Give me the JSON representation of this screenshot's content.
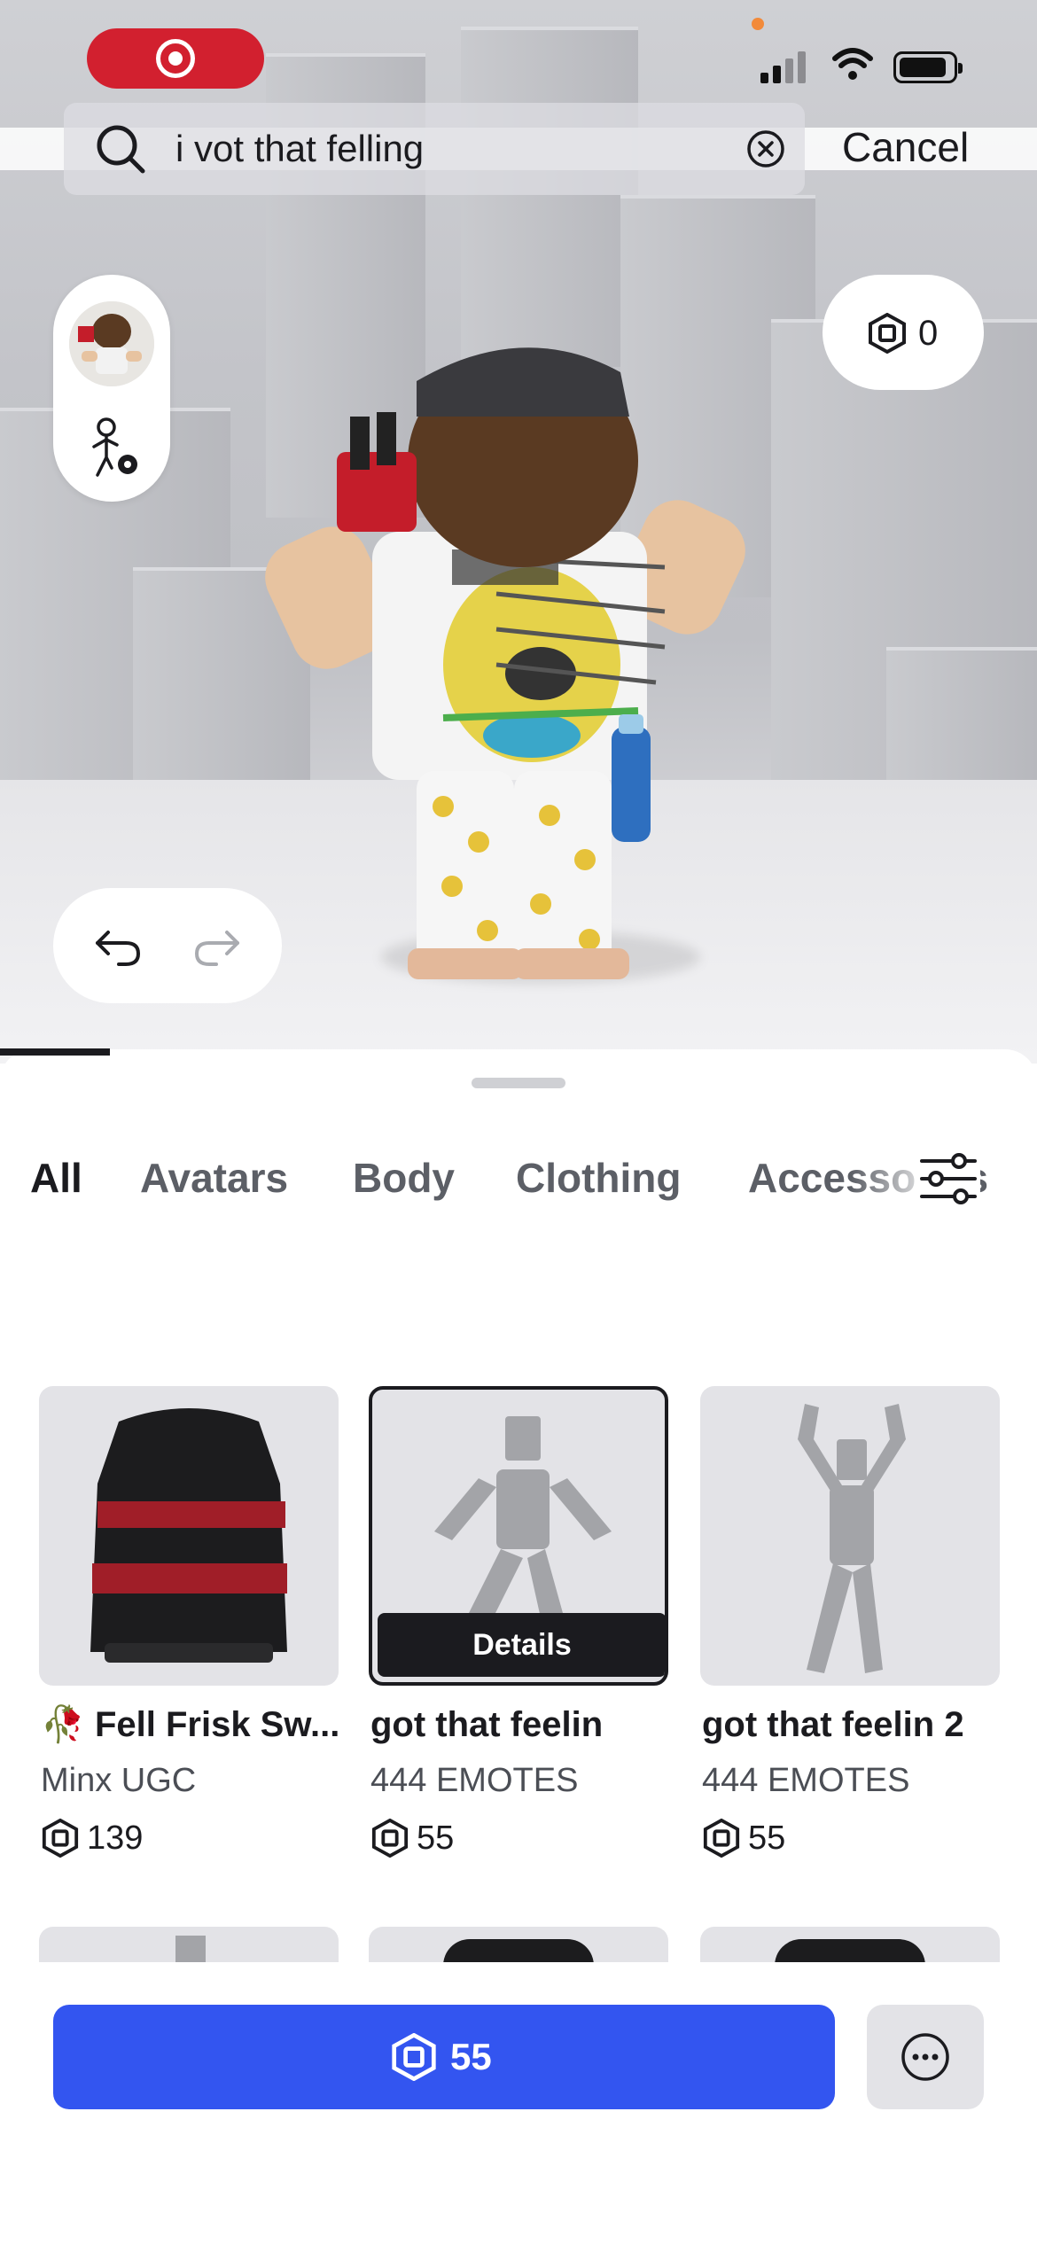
{
  "status_bar": {
    "app_pill_icon": "target-icon",
    "signal_icon": "cellular-signal-icon",
    "wifi_icon": "wifi-icon",
    "battery_icon": "battery-icon"
  },
  "search": {
    "query": "i vot that felling",
    "cancel_label": "Cancel"
  },
  "balance": {
    "value": "0"
  },
  "tabs": [
    {
      "label": "All",
      "active": true
    },
    {
      "label": "Avatars",
      "active": false
    },
    {
      "label": "Body",
      "active": false
    },
    {
      "label": "Clothing",
      "active": false
    },
    {
      "label": "Accessories",
      "active": false
    }
  ],
  "items": [
    {
      "name": "Fell Frisk Sw...",
      "creator": "Minx UGC",
      "price": "139",
      "selected": false
    },
    {
      "name": "got that feelin",
      "creator": "444 EMOTES",
      "price": "55",
      "selected": true,
      "details_label": "Details"
    },
    {
      "name": "got that feelin 2",
      "creator": "444 EMOTES",
      "price": "55",
      "selected": false
    }
  ],
  "buy_button": {
    "price": "55"
  },
  "colors": {
    "accent": "#3355f0",
    "target_red": "#d2202f",
    "text_primary": "#1b1b1f",
    "text_secondary": "#5c5f66"
  }
}
